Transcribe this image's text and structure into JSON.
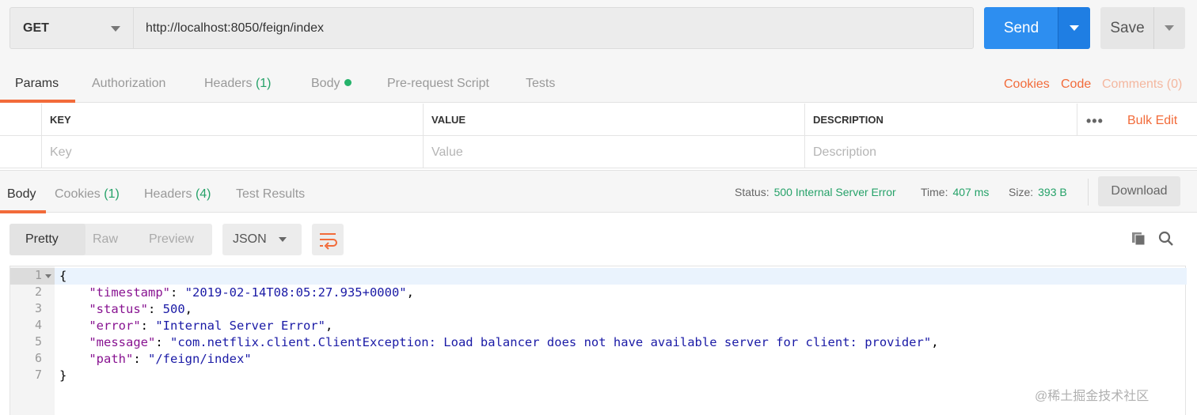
{
  "request": {
    "method": "GET",
    "url": "http://localhost:8050/feign/index",
    "send_label": "Send",
    "save_label": "Save"
  },
  "request_tabs": {
    "params": "Params",
    "authorization": "Authorization",
    "headers": "Headers",
    "headers_count": "(1)",
    "body": "Body",
    "prerequest": "Pre-request Script",
    "tests": "Tests",
    "cookies": "Cookies",
    "code": "Code",
    "comments": "Comments (0)"
  },
  "params_table": {
    "col_key": "KEY",
    "col_value": "VALUE",
    "col_description": "DESCRIPTION",
    "more": "•••",
    "bulk_edit": "Bulk Edit",
    "placeholder_key": "Key",
    "placeholder_value": "Value",
    "placeholder_description": "Description"
  },
  "response_tabs": {
    "body": "Body",
    "cookies": "Cookies",
    "cookies_count": "(1)",
    "headers": "Headers",
    "headers_count": "(4)",
    "test_results": "Test Results"
  },
  "response_meta": {
    "status_label": "Status:",
    "status_value": "500 Internal Server Error",
    "time_label": "Time:",
    "time_value": "407 ms",
    "size_label": "Size:",
    "size_value": "393 B",
    "download": "Download"
  },
  "body_toolbar": {
    "pretty": "Pretty",
    "raw": "Raw",
    "preview": "Preview",
    "format": "JSON"
  },
  "editor": {
    "line_numbers": [
      "1",
      "2",
      "3",
      "4",
      "5",
      "6",
      "7"
    ],
    "open_brace": "{",
    "close_brace": "}",
    "k_timestamp": "\"timestamp\"",
    "v_timestamp": "\"2019-02-14T08:05:27.935+0000\"",
    "k_status": "\"status\"",
    "v_status": "500",
    "k_error": "\"error\"",
    "v_error": "\"Internal Server Error\"",
    "k_message": "\"message\"",
    "v_message": "\"com.netflix.client.ClientException: Load balancer does not have available server for client: provider\"",
    "k_path": "\"path\"",
    "v_path": "\"/feign/index\""
  },
  "watermark": "@稀土掘金技术社区",
  "colors": {
    "accent": "#f26b3a",
    "send_blue": "#2d8ef0",
    "success_green": "#26a269",
    "json_key": "#881391",
    "json_string": "#1a1aa6"
  }
}
